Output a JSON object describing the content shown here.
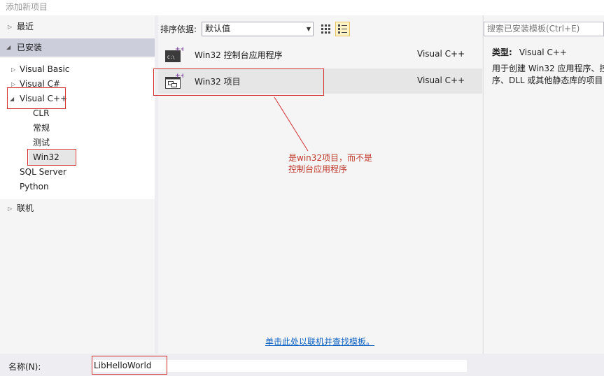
{
  "window": {
    "title": "添加新项目"
  },
  "tree": {
    "recent": "最近",
    "installed": "已安装",
    "items": [
      "Visual Basic",
      "Visual C#",
      "Visual C++"
    ],
    "cpp_children": [
      "CLR",
      "常规",
      "测试",
      "Win32"
    ],
    "others": [
      "SQL Server",
      "Python"
    ],
    "online": "联机"
  },
  "toolbar": {
    "sort_label": "排序依据:",
    "sort_value": "默认值"
  },
  "search": {
    "placeholder": "搜索已安装模板(Ctrl+E)"
  },
  "templates": [
    {
      "name": "Win32 控制台应用程序",
      "lang": "Visual C++",
      "icon": "console-app-icon"
    },
    {
      "name": "Win32 项目",
      "lang": "Visual C++",
      "icon": "win32-project-icon"
    }
  ],
  "details": {
    "type_label": "类型:",
    "type_value": "Visual C++",
    "desc_line1": "用于创建 Win32 应用程序、控",
    "desc_line2": "序、DLL 或其他静态库的项目"
  },
  "online_link": "单击此处以联机并查找模板。",
  "name_field": {
    "label": "名称(N):",
    "value": "LibHelloWorld"
  },
  "annotation": {
    "line1": "是win32项目，而不是",
    "line2": "控制台应用程序"
  },
  "colors": {
    "annotation_red": "#d32f2f",
    "link_blue": "#0e61c1",
    "selection": "#cccedb"
  }
}
